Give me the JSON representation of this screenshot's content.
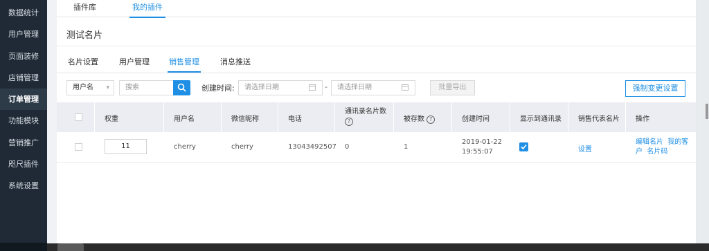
{
  "sidebar": {
    "items": [
      {
        "label": "数据统计"
      },
      {
        "label": "用户管理"
      },
      {
        "label": "页面装修"
      },
      {
        "label": "店铺管理"
      },
      {
        "label": "订单管理"
      },
      {
        "label": "功能模块"
      },
      {
        "label": "营销推广"
      },
      {
        "label": "咫尺插件"
      },
      {
        "label": "系统设置"
      }
    ]
  },
  "top_tabs": [
    {
      "label": "插件库"
    },
    {
      "label": "我的插件"
    }
  ],
  "page": {
    "title": "测试名片"
  },
  "sub_tabs": [
    {
      "label": "名片设置"
    },
    {
      "label": "用户管理"
    },
    {
      "label": "销售管理"
    },
    {
      "label": "消息推送"
    }
  ],
  "filters": {
    "select_value": "用户名",
    "search_placeholder": "搜索",
    "created_label": "创建时间:",
    "date_start_placeholder": "请选择日期",
    "date_end_placeholder": "请选择日期",
    "dash": "-",
    "export_label": "批量导出",
    "force_label": "强制变更设置"
  },
  "table": {
    "headers": {
      "weight": "权重",
      "username": "用户名",
      "wechat": "微信昵称",
      "phone": "电话",
      "address_count_line1": "通讯录名片数",
      "saved": "被存数",
      "created": "创建时间",
      "show_in_addr": "显示到通讯录",
      "sales_card": "销售代表名片",
      "ops": "操作"
    },
    "rows": [
      {
        "weight": "11",
        "username": "cherry",
        "wechat": "cherry",
        "phone": "13043492507",
        "address_count": "0",
        "saved": "1",
        "created_date": "2019-01-22",
        "created_time": "19:55:07",
        "show_in_addr": true,
        "sales_card": "设置",
        "op_edit": "编辑名片",
        "op_customers_a": "我的客",
        "op_customers_b": "户",
        "op_qrcode": "名片码"
      }
    ]
  }
}
